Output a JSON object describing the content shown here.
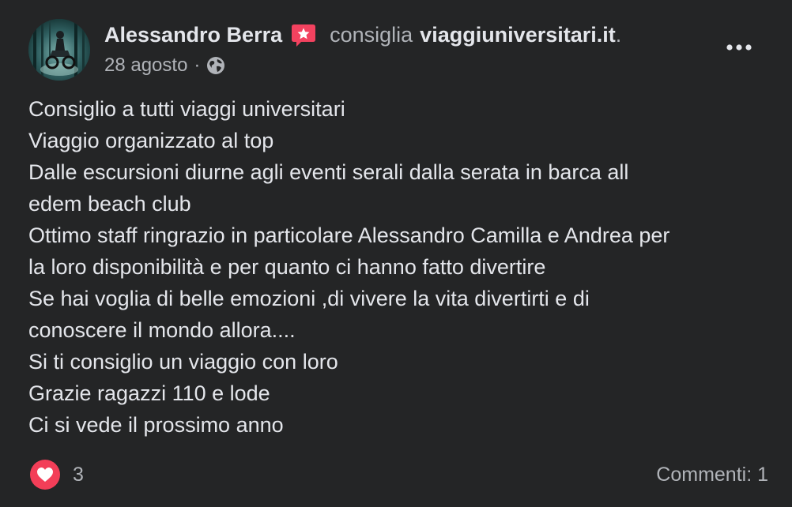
{
  "post": {
    "author_name": "Alessandro Berra",
    "action_verb": "consiglia",
    "page_name": "viaggiuniversitari.it",
    "page_suffix": ".",
    "date": "28 agosto",
    "separator": "·",
    "privacy_icon": "globe-icon",
    "recommend_icon": "star-recommend-icon",
    "more_icon": "more-options-icon",
    "lines": [
      "Consiglio a tutti viaggi universitari",
      "Viaggio organizzato al top",
      "Dalle escursioni diurne agli eventi serali dalla serata in barca all",
      "edem beach club",
      "Ottimo staff ringrazio in particolare Alessandro Camilla e Andrea per",
      "la loro disponibilità e per quanto ci hanno fatto divertire",
      "Se hai voglia di belle emozioni ,di vivere la vita divertirti e di",
      "conoscere il mondo allora....",
      "Si ti consiglio un viaggio con loro",
      "Grazie ragazzi 110 e lode",
      "Ci si vede il prossimo anno"
    ]
  },
  "footer": {
    "reaction_icon": "heart-reaction-icon",
    "reaction_count": "3",
    "comments_label": "Commenti: 1"
  },
  "colors": {
    "background": "#242526",
    "primary_text": "#e4e6eb",
    "secondary_text": "#b0b3b8",
    "heart": "#f33e58",
    "recommend_badge": "#f3425f"
  }
}
